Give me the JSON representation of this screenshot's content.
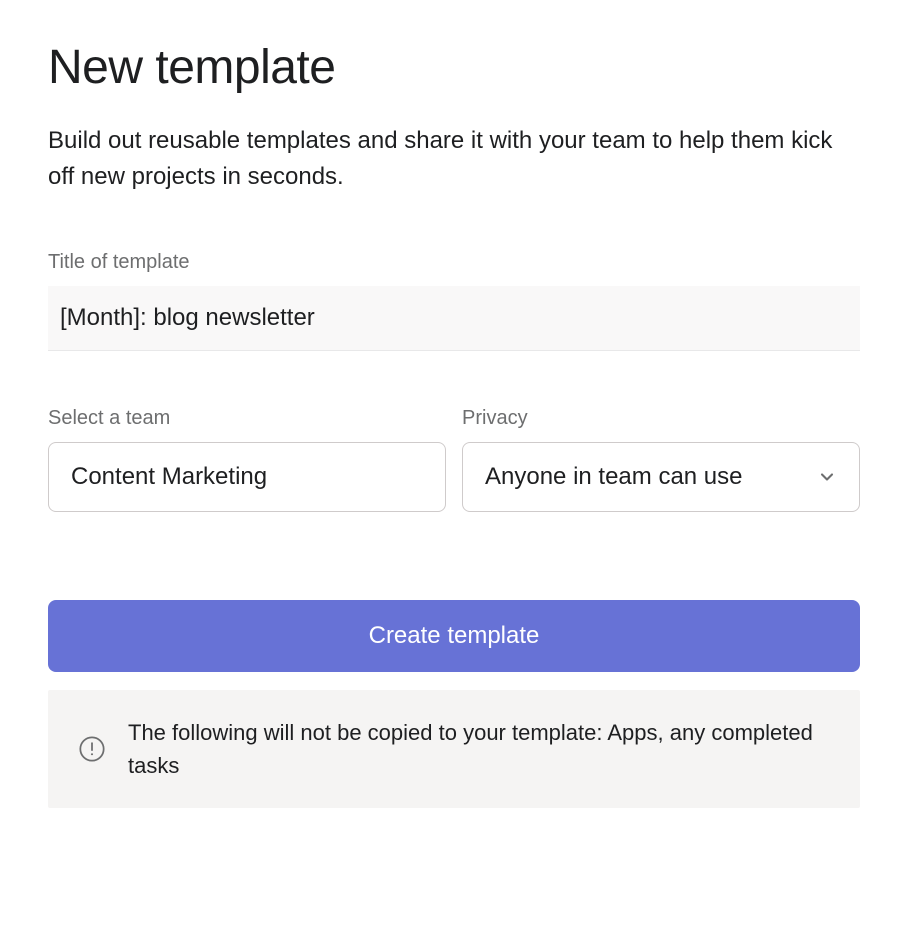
{
  "header": {
    "title": "New template",
    "description": "Build out reusable templates and share it with your team to help them kick off new projects in seconds."
  },
  "form": {
    "title_field": {
      "label": "Title of template",
      "value": "[Month]: blog newsletter"
    },
    "team_field": {
      "label": "Select a team",
      "value": "Content Marketing"
    },
    "privacy_field": {
      "label": "Privacy",
      "value": "Anyone in team can use"
    },
    "submit_label": "Create template"
  },
  "info_banner": {
    "text": "The following will not be copied to your template: Apps, any completed tasks"
  }
}
